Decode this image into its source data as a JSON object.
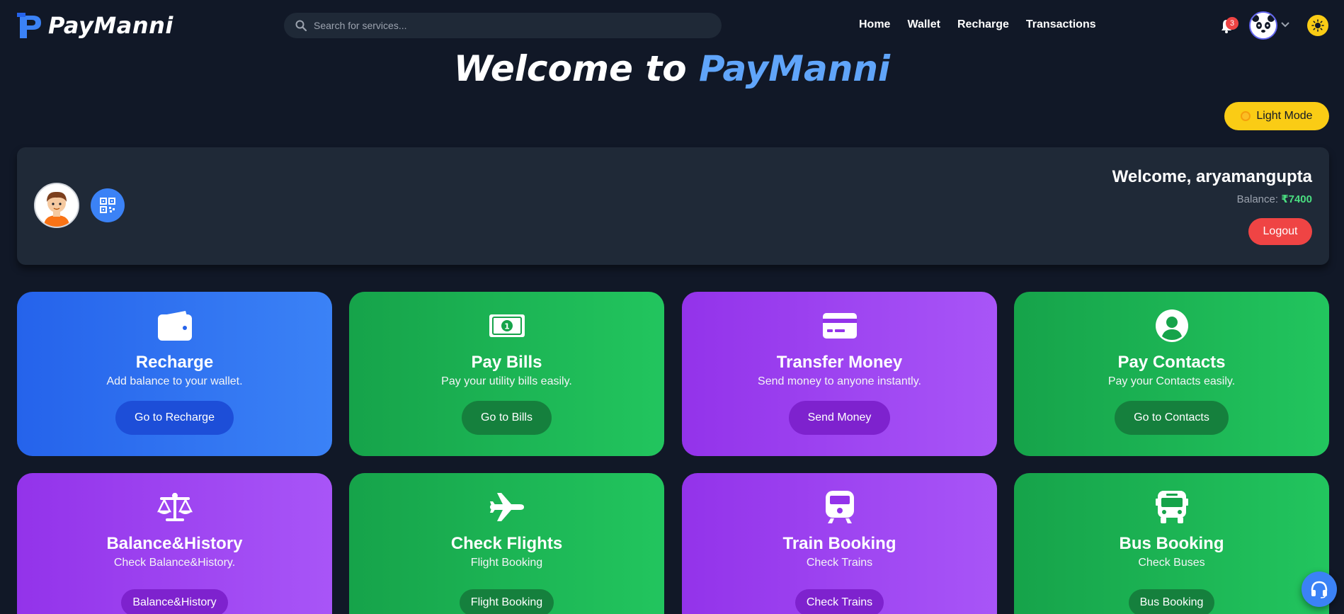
{
  "navbar": {
    "brand_name": "PayManni",
    "search_placeholder": "Search for services...",
    "links": [
      "Home",
      "Wallet",
      "Recharge",
      "Transactions"
    ],
    "notification_count": "3"
  },
  "header": {
    "title_prefix": "Welcome to ",
    "title_accent": "PayManni",
    "light_mode_label": "Light Mode"
  },
  "profile": {
    "welcome": "Welcome, aryamangupta",
    "balance_label": "Balance: ",
    "balance_value": "₹7400",
    "logout_label": "Logout"
  },
  "cards": [
    {
      "title": "Recharge",
      "desc": "Add balance to your wallet.",
      "button": "Go to Recharge",
      "icon": "wallet-icon"
    },
    {
      "title": "Pay Bills",
      "desc": "Pay your utility bills easily.",
      "button": "Go to Bills",
      "icon": "money-bill-icon"
    },
    {
      "title": "Transfer Money",
      "desc": "Send money to anyone instantly.",
      "button": "Send Money",
      "icon": "credit-card-icon"
    },
    {
      "title": "Pay Contacts",
      "desc": "Pay your Contacts easily.",
      "button": "Go to Contacts",
      "icon": "user-circle-icon"
    },
    {
      "title": "Balance&History",
      "desc": "Check Balance&History.",
      "button": "Balance&History",
      "icon": "scale-icon"
    },
    {
      "title": "Check Flights",
      "desc": "Flight Booking",
      "button": "Flight Booking",
      "icon": "plane-icon"
    },
    {
      "title": "Train Booking",
      "desc": "Check Trains",
      "button": "Check Trains",
      "icon": "train-icon"
    },
    {
      "title": "Bus Booking",
      "desc": "Check Buses",
      "button": "Bus Booking",
      "icon": "bus-icon"
    }
  ],
  "colors": {
    "background": "#111827",
    "panel": "#1f2937",
    "accent_blue": "#60a5fa",
    "yellow": "#facc15",
    "danger": "#ef4444",
    "balance_green": "#4ade80"
  }
}
